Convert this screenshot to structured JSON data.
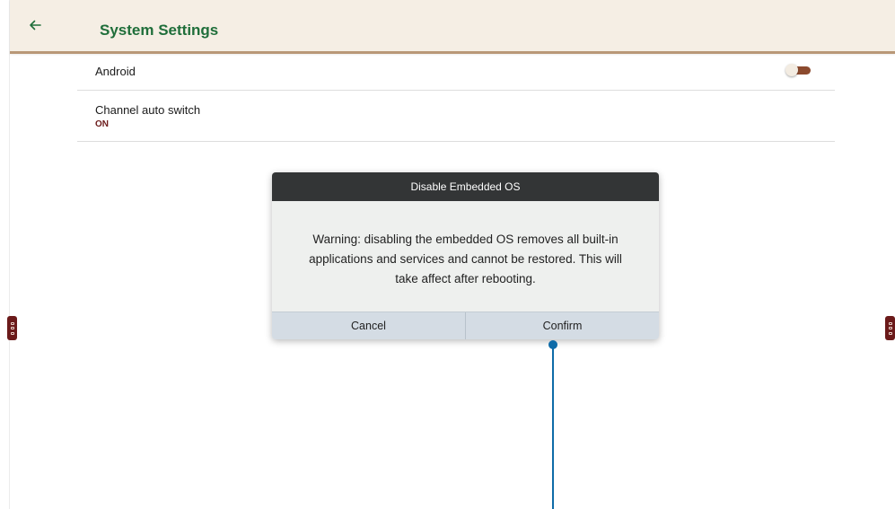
{
  "appbar": {
    "title": "System Settings",
    "back_icon": "arrow-left-icon",
    "back_glyph": "←"
  },
  "settings": {
    "android": {
      "label": "Android",
      "toggle_on": false
    },
    "channel_auto_switch": {
      "label": "Channel auto switch",
      "value": "ON"
    }
  },
  "dialog": {
    "title": "Disable Embedded OS",
    "message": "Warning: disabling the embedded OS removes all built-in applications and services and cannot be restored.  This will take affect after rebooting.",
    "cancel_label": "Cancel",
    "confirm_label": "Confirm"
  },
  "colors": {
    "appbar_bg": "#f5eee4",
    "appbar_border": "#b99877",
    "title_green": "#1f6e3a",
    "accent_maroon": "#6b1a1a",
    "dialog_header": "#333536",
    "dialog_actions": "#d4dce4",
    "callout": "#0e6ba8"
  }
}
